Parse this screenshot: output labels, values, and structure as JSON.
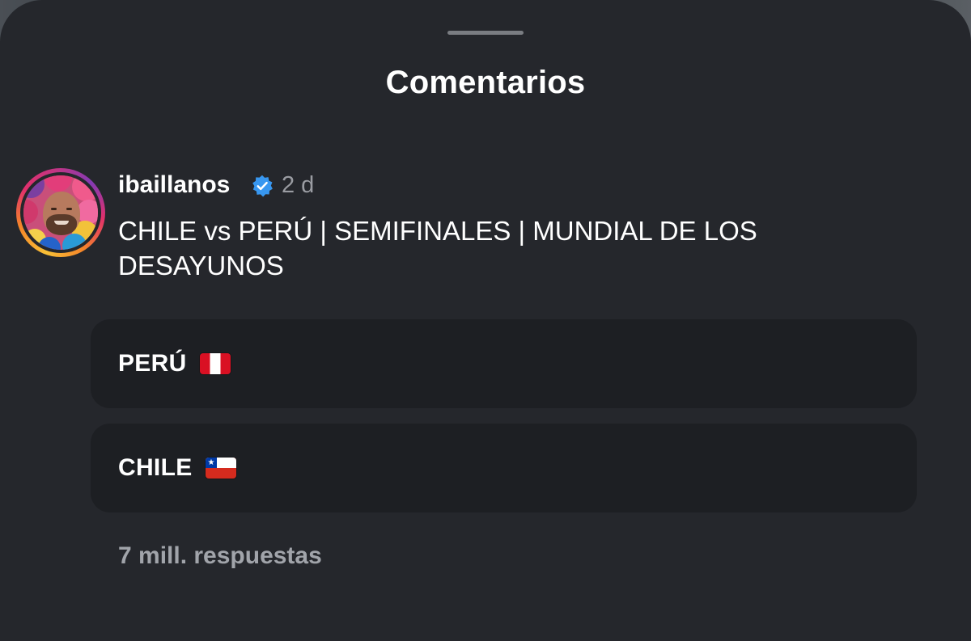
{
  "sheet": {
    "title": "Comentarios"
  },
  "comment": {
    "username": "ibaillanos",
    "verified": true,
    "timestamp": "2 d",
    "text": "CHILE vs PERÚ | SEMIFINALES | MUNDIAL DE LOS DESAYUNOS",
    "avatar_icon": "profile-photo"
  },
  "poll": {
    "options": [
      {
        "label": "PERÚ",
        "flag_icon": "peru-flag-icon"
      },
      {
        "label": "CHILE",
        "flag_icon": "chile-flag-icon"
      }
    ]
  },
  "replies": {
    "label": "7 mill. respuestas"
  },
  "colors": {
    "background": "#25272c",
    "option_background": "#1d1f23",
    "text_primary": "#ffffff",
    "text_secondary": "#9a9ca2",
    "verified_blue": "#3897f0"
  }
}
